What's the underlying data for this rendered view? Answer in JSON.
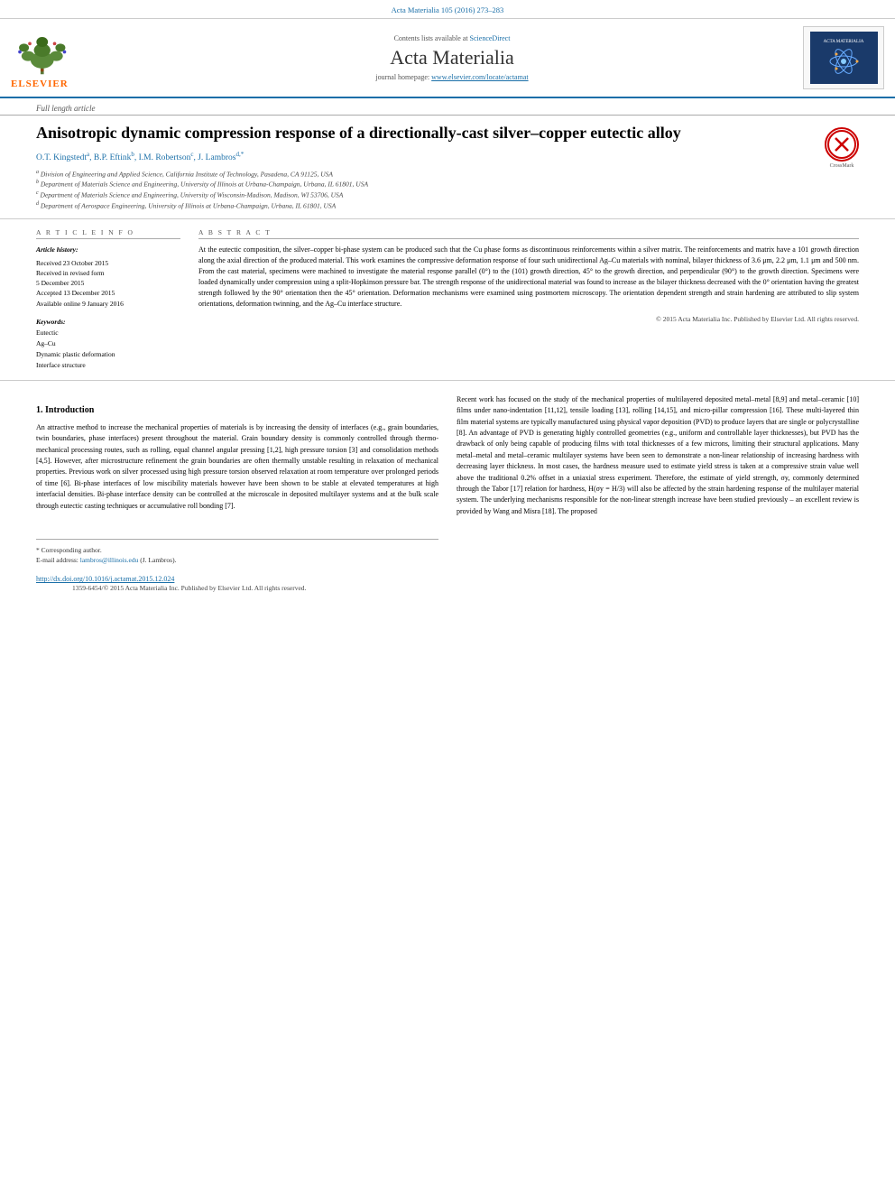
{
  "topbar": {
    "citation": "Acta Materialia 105 (2016) 273–283"
  },
  "journal_header": {
    "contents_label": "Contents lists available at",
    "sciencedirect_link": "ScienceDirect",
    "journal_name": "Acta Materialia",
    "homepage_label": "journal homepage:",
    "homepage_url": "www.elsevier.com/locate/actamat",
    "elsevier_label": "ELSEVIER"
  },
  "article": {
    "type": "Full length article",
    "title": "Anisotropic dynamic compression response of a directionally-cast silver–copper eutectic alloy",
    "authors": "O.T. Kingstedt a, B.P. Eftink b, I.M. Robertson c, J. Lambros d,*",
    "affiliations": [
      {
        "sup": "a",
        "text": "Division of Engineering and Applied Science, California Institute of Technology, Pasadena, CA 91125, USA"
      },
      {
        "sup": "b",
        "text": "Department of Materials Science and Engineering, University of Illinois at Urbana-Champaign, Urbana, IL 61801, USA"
      },
      {
        "sup": "c",
        "text": "Department of Materials Science and Engineering, University of Wisconsin-Madison, Madison, WI 53706, USA"
      },
      {
        "sup": "d",
        "text": "Department of Aerospace Engineering, University of Illinois at Urbana-Champaign, Urbana, IL 61801, USA"
      }
    ]
  },
  "article_info": {
    "heading": "A R T I C L E   I N F O",
    "history_label": "Article history:",
    "received": "Received 23 October 2015",
    "revised": "Received in revised form",
    "revised_date": "5 December 2015",
    "accepted": "Accepted 13 December 2015",
    "available": "Available online 9 January 2016",
    "keywords_label": "Keywords:",
    "keywords": [
      "Eutectic",
      "Ag–Cu",
      "Dynamic plastic deformation",
      "Interface structure"
    ]
  },
  "abstract": {
    "heading": "A B S T R A C T",
    "text": "At the eutectic composition, the silver–copper bi-phase system can be produced such that the Cu phase forms as discontinuous reinforcements within a silver matrix. The reinforcements and matrix have a 101 growth direction along the axial direction of the produced material. This work examines the compressive deformation response of four such unidirectional Ag–Cu materials with nominal, bilayer thickness of 3.6 μm, 2.2 μm, 1.1 μm and 500 nm. From the cast material, specimens were machined to investigate the material response parallel (0°) to the (101) growth direction, 45° to the growth direction, and perpendicular (90°) to the growth direction. Specimens were loaded dynamically under compression using a split-Hopkinson pressure bar. The strength response of the unidirectional material was found to increase as the bilayer thickness decreased with the 0° orientation having the greatest strength followed by the 90° orientation then the 45° orientation. Deformation mechanisms were examined using postmortem microscopy. The orientation dependent strength and strain hardening are attributed to slip system orientations, deformation twinning, and the Ag–Cu interface structure.",
    "copyright": "© 2015 Acta Materialia Inc. Published by Elsevier Ltd. All rights reserved."
  },
  "intro": {
    "section_number": "1.",
    "section_title": "Introduction",
    "para1": "An attractive method to increase the mechanical properties of materials is by increasing the density of interfaces (e.g., grain boundaries, twin boundaries, phase interfaces) present throughout the material. Grain boundary density is commonly controlled through thermo-mechanical processing routes, such as rolling, equal channel angular pressing [1,2], high pressure torsion [3] and consolidation methods [4,5]. However, after microstructure refinement the grain boundaries are often thermally unstable resulting in relaxation of mechanical properties. Previous work on silver processed using high pressure torsion observed relaxation at room temperature over prolonged periods of time [6]. Bi-phase interfaces of low miscibility materials however have been shown to be stable at elevated temperatures at high interfacial densities. Bi-phase interface density can be controlled at the microscale in deposited multilayer systems and at the bulk scale through eutectic casting techniques or accumulative roll bonding [7].",
    "para2": "Recent work has focused on the study of the mechanical properties of multilayered deposited metal–metal [8,9] and metal–ceramic [10] films under nano-indentation [11,12], tensile loading [13], rolling [14,15], and micro-pillar compression [16]. These multi-layered thin film material systems are typically manufactured using physical vapor deposition (PVD) to produce layers that are single or polycrystalline [8]. An advantage of PVD is generating highly controlled geometries (e.g., uniform and controllable layer thicknesses), but PVD has the drawback of only being capable of producing films with total thicknesses of a few microns, limiting their structural applications. Many metal–metal and metal–ceramic multilayer systems have been seen to demonstrate a non-linear relationship of increasing hardness with decreasing layer thickness. In most cases, the hardness measure used to estimate yield stress is taken at a compressive strain value well above the traditional 0.2% offset in a uniaxial stress experiment. Therefore, the estimate of yield strength, σy, commonly determined through the Tabor [17] relation for hardness, H(σy = H/3) will also be affected by the strain hardening response of the multilayer material system. The underlying mechanisms responsible for the non-linear strength increase have been studied previously – an excellent review is provided by Wang and Misra [18]. The proposed"
  },
  "footnotes": {
    "corresponding": "* Corresponding author.",
    "email_label": "E-mail address:",
    "email": "lambros@illinois.edu",
    "email_suffix": "(J. Lambros).",
    "doi": "http://dx.doi.org/10.1016/j.actamat.2015.12.024",
    "rights": "1359-6454/© 2015 Acta Materialia Inc. Published by Elsevier Ltd. All rights reserved."
  }
}
